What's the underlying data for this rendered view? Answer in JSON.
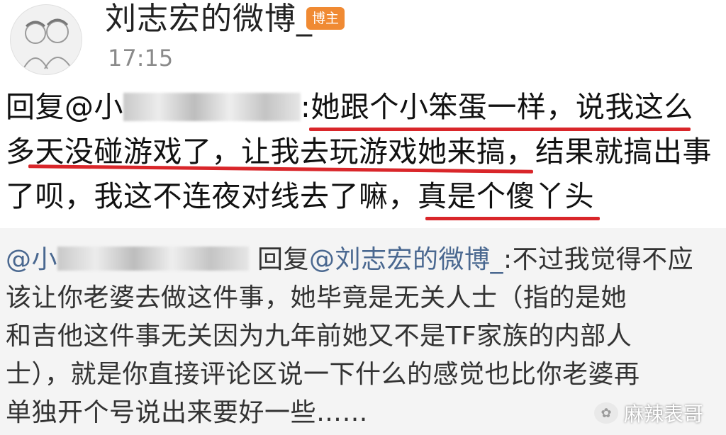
{
  "post": {
    "username": "刘志宏的微博_",
    "badge": "博主",
    "time": "17:15"
  },
  "reply": {
    "prefix": "回复@小",
    "mention_suffix": ":",
    "line1_main": "她跟个小笨蛋一样，说我这么",
    "line2": "多天没碰游戏了，让我去玩游戏她来搞，结果就搞出事",
    "line3_start": "了呗，我这不连夜对线去了嘛，",
    "line3_end": "真是个傻丫头"
  },
  "quoted_comment": {
    "mention_start": "@小",
    "reply_label": "回复",
    "reply_target": "@刘志宏的微博_",
    "line1_text": ":不过我觉得不应",
    "line2": "该让你老婆去做这件事，她毕竟是无关人士（指的是她",
    "line3": "和吉他这件事无关因为九年前她又不是TF家族的内部人",
    "line4": "士），就是你直接评论区说一下什么的感觉也比你老婆再",
    "line5": "单独开个号说出来要好一些……"
  },
  "watermark": {
    "text": "麻辣表哥"
  },
  "colors": {
    "underline": "#d9262a",
    "badge": "#f08a33",
    "mention": "#4a6890",
    "panel_bg": "#f4f4f4"
  }
}
